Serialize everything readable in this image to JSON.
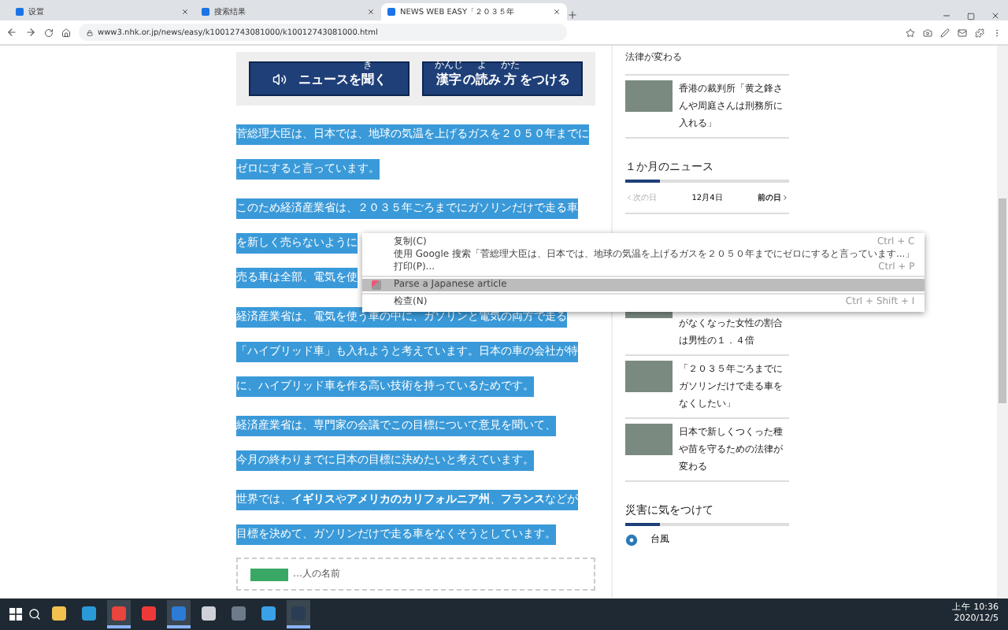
{
  "browser": {
    "tabs": [
      {
        "title": "设置",
        "selected": false
      },
      {
        "title": "搜索结果",
        "selected": false
      },
      {
        "title": "NEWS WEB EASY「２０３５年",
        "selected": true
      }
    ],
    "address": "www3.nhk.or.jp/news/easy/k10012743081000/k10012743081000.html"
  },
  "article": {
    "buttons": [
      {
        "kind": "audio",
        "parts": [
          {
            "base": "ニュースを"
          },
          {
            "base": "聞",
            "ruby": "き"
          },
          {
            "base": "く"
          }
        ]
      },
      {
        "kind": "ruby",
        "parts": [
          {
            "base": "漢字",
            "ruby": "かんじ"
          },
          {
            "base": "の"
          },
          {
            "base": "読",
            "ruby": "よ"
          },
          {
            "base": "み"
          },
          {
            "base": "方",
            "ruby": "かた"
          },
          {
            "base": "をつける"
          }
        ]
      }
    ],
    "paragraphs": [
      {
        "lines": [
          "菅総理大臣は、日本では、地球の気温を上げるガスを２０５０年までに",
          "ゼロにすると言っています。"
        ]
      },
      {
        "lines": [
          "このため経済産業省は、２０３５年ごろまでにガソリンだけで走る車",
          "を新しく売らないように",
          "売る車は全部、電気を使"
        ]
      },
      {
        "lines": [
          "経済産業省は、電気を使う車の中に、ガソリンと電気の両方で走る",
          "「ハイブリッド車」も入れようと考えています。日本の車の会社が特",
          "に、ハイブリッド車を作る高い技術を持っているためです。"
        ]
      },
      {
        "lines": [
          "経済産業省は、専門家の会議でこの目標について意見を聞いて、",
          "今月の終わりまでに日本の目標に決めたいと考えています。"
        ]
      },
      {
        "lines": [
          "世界では、**イギリス**や**アメリカのカリフォルニア州**、**フランス**などが",
          "目標を決めて、ガソリンだけで走る車をなくそうとしています。"
        ]
      }
    ],
    "legend": "…人の名前"
  },
  "context_menu": [
    {
      "kind": "item",
      "label": "复制(C)",
      "shortcut": "Ctrl + C",
      "selected": false
    },
    {
      "kind": "item",
      "label": "使用 Google 搜索「菅総理大臣は、日本では、地球の気温を上げるガスを２０５０年までにゼロにすると言っています...」",
      "selected": false
    },
    {
      "kind": "item",
      "label": "打印(P)...",
      "shortcut": "Ctrl + P",
      "selected": false
    },
    {
      "kind": "extension",
      "label": "Parse a Japanese article",
      "selected": true
    },
    {
      "kind": "item",
      "label": "检查(N)",
      "shortcut": "Ctrl + Shift + I",
      "selected": false
    }
  ],
  "sidebar": {
    "top_fragment": "法律が変わる",
    "top_items": [
      {
        "title": "香港の裁判所「黄之鋒さんや周庭さんは刑務所に入れる」"
      }
    ],
    "month_heading": "１か月のニュース",
    "nav": {
      "prev": "次の日",
      "date": "12月4日",
      "next": "前の日"
    },
    "month_items": [
      {
        "title": "がなくなった女性の割合は男性の１．４倍"
      },
      {
        "title": "「２０３５年ごろまでにガソリンだけで走る車をなくしたい」"
      },
      {
        "title": "日本で新しくつくった種や苗を守るための法律が変わる"
      }
    ],
    "disaster_heading": "災害に気をつけて",
    "disaster_items": [
      {
        "label": "台風"
      }
    ]
  },
  "taskbar": {
    "apps": [
      {
        "kind": "folder",
        "active": false
      },
      {
        "kind": "edge",
        "active": false
      },
      {
        "kind": "chrome",
        "active": true
      },
      {
        "kind": "vivaldi",
        "active": false
      },
      {
        "kind": "vscode",
        "active": true
      },
      {
        "kind": "app",
        "active": false
      },
      {
        "kind": "calculator",
        "active": false
      },
      {
        "kind": "ie",
        "active": false
      },
      {
        "kind": "terminal",
        "active": true
      }
    ],
    "time": "上午 10:36",
    "date": "2020/12/5"
  }
}
